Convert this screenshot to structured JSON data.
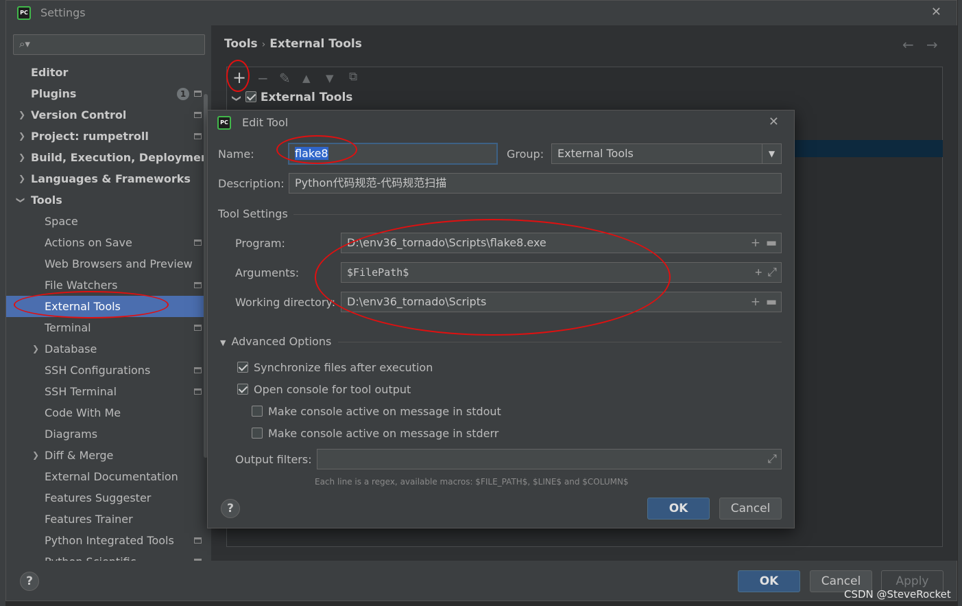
{
  "window": {
    "title": "Settings"
  },
  "search": {
    "placeholder": ""
  },
  "sidebar": {
    "items": [
      {
        "label": "Editor"
      },
      {
        "label": "Plugins",
        "badge": "1"
      },
      {
        "label": "Version Control"
      },
      {
        "label": "Project: rumpetroll"
      },
      {
        "label": "Build, Execution, Deployment"
      },
      {
        "label": "Languages & Frameworks"
      },
      {
        "label": "Tools"
      },
      {
        "label": "Space"
      },
      {
        "label": "Actions on Save"
      },
      {
        "label": "Web Browsers and Preview"
      },
      {
        "label": "File Watchers"
      },
      {
        "label": "External Tools"
      },
      {
        "label": "Terminal"
      },
      {
        "label": "Database"
      },
      {
        "label": "SSH Configurations"
      },
      {
        "label": "SSH Terminal"
      },
      {
        "label": "Code With Me"
      },
      {
        "label": "Diagrams"
      },
      {
        "label": "Diff & Merge"
      },
      {
        "label": "External Documentation"
      },
      {
        "label": "Features Suggester"
      },
      {
        "label": "Features Trainer"
      },
      {
        "label": "Python Integrated Tools"
      },
      {
        "label": "Python Scientific"
      }
    ]
  },
  "breadcrumb": {
    "parent": "Tools",
    "current": "External Tools"
  },
  "tools_tree": {
    "root_label": "External Tools"
  },
  "dialog": {
    "title": "Edit Tool",
    "name_label": "Name:",
    "name_value": "flake8",
    "group_label": "Group:",
    "group_value": "External Tools",
    "description_label": "Description:",
    "description_value": "Python代码规范-代码规范扫描",
    "tool_settings_label": "Tool Settings",
    "program_label": "Program:",
    "program_value": "D:\\env36_tornado\\Scripts\\flake8.exe",
    "arguments_label": "Arguments:",
    "arguments_value": "$FilePath$",
    "workdir_label": "Working directory:",
    "workdir_value": "D:\\env36_tornado\\Scripts",
    "advanced_label": "Advanced Options",
    "opt_sync": "Synchronize files after execution",
    "opt_console": "Open console for tool output",
    "opt_stdout": "Make console active on message in stdout",
    "opt_stderr": "Make console active on message in stderr",
    "output_filters_label": "Output filters:",
    "output_filters_value": "",
    "hint": "Each line is a regex, available macros: $FILE_PATH$, $LINE$ and $COLUMN$",
    "ok_label": "OK",
    "cancel_label": "Cancel",
    "help_label": "?"
  },
  "footer": {
    "ok_label": "OK",
    "cancel_label": "Cancel",
    "apply_label": "Apply",
    "help_label": "?"
  },
  "watermark": "CSDN @SteveRocket",
  "icons": {
    "app": "pycharm-logo",
    "search": "search-icon",
    "close": "close-icon",
    "add": "plus-icon",
    "remove": "minus-icon",
    "edit": "pencil-icon",
    "up": "arrow-up-icon",
    "down": "arrow-down-icon",
    "copy": "copy-icon",
    "back": "arrow-left-icon",
    "forward": "arrow-right-icon",
    "folder": "folder-icon",
    "expand": "expand-icon"
  },
  "colors": {
    "selection": "#4b6eaf",
    "primary_button": "#365880",
    "annotation": "#e01010",
    "background": "#3c3f41"
  }
}
